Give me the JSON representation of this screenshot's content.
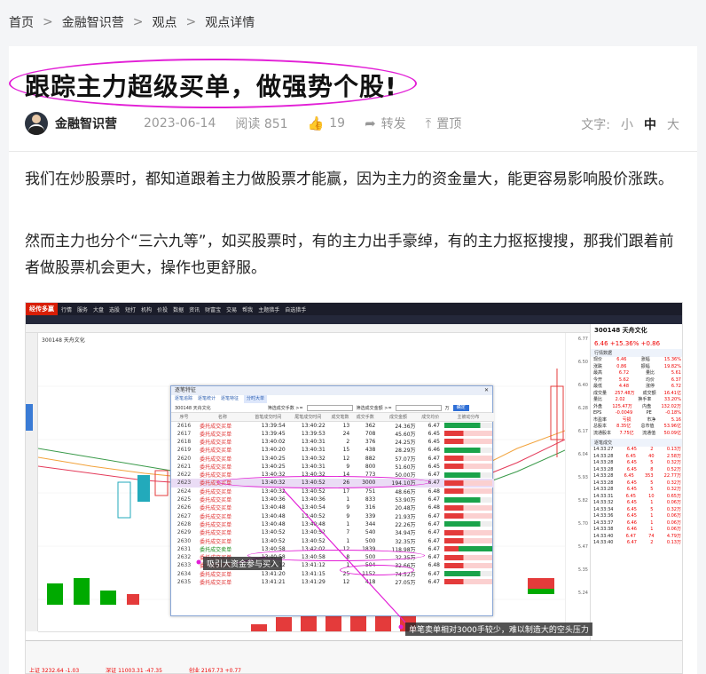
{
  "breadcrumb": {
    "items": [
      "首页",
      "金融智识营",
      "观点",
      "观点详情"
    ],
    "separator": ">"
  },
  "article": {
    "title": "跟踪主力超级买单，做强势个股!",
    "author": "金融智识营",
    "date": "2023-06-14",
    "views_label": "阅读 851",
    "likes": "19",
    "forward_label": "转发",
    "pin_label": "置顶",
    "fontsize_label": "文字:",
    "fontsize_options": [
      "小",
      "中",
      "大"
    ],
    "fontsize_active": "中",
    "paragraphs": [
      "我们在炒股票时，都知道跟着主力做股票才能赢，因为主力的资金量大，能更容易影响股价涨跌。",
      "然而主力也分个“三六九等”，如买股票时，有的主力出手豪绰，有的主力抠抠搜搜，那我们跟着前者做股票机会更大，操作也更舒服。"
    ]
  },
  "screenshot": {
    "app_name": "经传多赢",
    "menu": [
      "行情",
      "服务",
      "大盘",
      "选股",
      "短打",
      "机构",
      "价投",
      "数据",
      "资讯",
      "财富宝",
      "交易",
      "帮我",
      "主题猎手",
      "自选猎手"
    ],
    "stock": {
      "code_name": "300148 天舟文化",
      "price": "6.46",
      "change": "+15.36%",
      "change_abs": "+0.86"
    },
    "annotation_1": "吸引大资金参与买入",
    "annotation_2": "单笔卖单相对3000手较少，难以制造大的空头压力",
    "dialog": {
      "title": "逐笔特征",
      "tabs": [
        "逐笔追踪",
        "逐笔统计",
        "逐笔特征",
        "分时大单"
      ],
      "stock": "300148 天舟文化",
      "filter1_label": "筛选成交手数 >=",
      "filter2_label": "筛选成交金额 >=",
      "filter_unit": "万",
      "confirm": "确定",
      "columns": [
        "序号",
        "名称",
        "首笔成交时间",
        "尾笔成交时间",
        "成交笔数",
        "成交手数",
        "成交金额",
        "成交均价",
        "主被动分布"
      ],
      "rows": [
        [
          "2616",
          "委托成交买单",
          "13:39:54",
          "13:40:22",
          "13",
          "362",
          "24.36万",
          "6.47"
        ],
        [
          "2617",
          "委托成交买单",
          "13:39:45",
          "13:39:53",
          "24",
          "708",
          "45.60万",
          "6.45"
        ],
        [
          "2618",
          "委托成交买单",
          "13:40:02",
          "13:40:31",
          "2",
          "376",
          "24.25万",
          "6.45"
        ],
        [
          "2619",
          "委托成交买单",
          "13:40:20",
          "13:40:31",
          "15",
          "438",
          "28.29万",
          "6.46"
        ],
        [
          "2620",
          "委托成交买单",
          "13:40:25",
          "13:40:32",
          "12",
          "882",
          "57.07万",
          "6.47"
        ],
        [
          "2621",
          "委托成交买单",
          "13:40:25",
          "13:40:31",
          "9",
          "800",
          "51.60万",
          "6.45"
        ],
        [
          "2622",
          "委托成交买单",
          "13:40:32",
          "13:40:32",
          "14",
          "773",
          "50.00万",
          "6.47"
        ],
        [
          "2623",
          "委托成交买单",
          "13:40:32",
          "13:40:52",
          "26",
          "3000",
          "194.10万",
          "6.47"
        ],
        [
          "2624",
          "委托成交买单",
          "13:40:32",
          "13:40:52",
          "17",
          "751",
          "48.66万",
          "6.48"
        ],
        [
          "2625",
          "委托成交买单",
          "13:40:36",
          "13:40:36",
          "1",
          "833",
          "53.90万",
          "6.47"
        ],
        [
          "2626",
          "委托成交买单",
          "13:40:48",
          "13:40:54",
          "9",
          "316",
          "20.48万",
          "6.48"
        ],
        [
          "2627",
          "委托成交买单",
          "13:40:48",
          "13:40:52",
          "9",
          "339",
          "21.93万",
          "6.47"
        ],
        [
          "2628",
          "委托成交买单",
          "13:40:48",
          "13:40:48",
          "1",
          "344",
          "22.26万",
          "6.47"
        ],
        [
          "2629",
          "委托成交买单",
          "13:40:52",
          "13:40:52",
          "7",
          "540",
          "34.94万",
          "6.47"
        ],
        [
          "2630",
          "委托成交买单",
          "13:40:52",
          "13:40:52",
          "1",
          "500",
          "32.35万",
          "6.47"
        ],
        [
          "2631",
          "委托成交卖单",
          "13:40:58",
          "13:42:02",
          "12",
          "1839",
          "118.98万",
          "6.47"
        ],
        [
          "2632",
          "委托成交买单",
          "13:40:58",
          "13:40:58",
          "8",
          "500",
          "32.35万",
          "6.47"
        ],
        [
          "2633",
          "委托成交买单",
          "13:41:12",
          "13:41:12",
          "1",
          "504",
          "32.66万",
          "6.48"
        ],
        [
          "2634",
          "委托成交买单",
          "13:41:20",
          "13:41:15",
          "25",
          "1152",
          "74.52万",
          "6.47"
        ],
        [
          "2635",
          "委托成交买单",
          "13:41:21",
          "13:41:29",
          "12",
          "418",
          "27.05万",
          "6.47"
        ]
      ]
    },
    "right_panel": {
      "section1": "行情数据",
      "rows": [
        [
          "现价",
          "6.46",
          "涨幅",
          "15.36%"
        ],
        [
          "涨跌",
          "0.86",
          "振幅",
          "19.82%"
        ],
        [
          "最高",
          "6.72",
          "量比",
          "5.61"
        ],
        [
          "今开",
          "5.62",
          "均价",
          "6.37"
        ],
        [
          "最低",
          "4.48",
          "涨停",
          "6.72"
        ],
        [
          "成交量",
          "257.48万",
          "成交额",
          "16.41亿"
        ],
        [
          "量比",
          "2.02",
          "换手率",
          "33.20%"
        ],
        [
          "外盘",
          "125.47万",
          "内盘",
          "132.02万"
        ],
        [
          "EPS",
          "-0.0049",
          "PE",
          "-0.18%"
        ],
        [
          "市盈率",
          "亏损",
          "市净",
          "5.16"
        ],
        [
          "总股本",
          "8.35亿",
          "总市值",
          "53.96亿"
        ],
        [
          "流通股本",
          "7.75亿",
          "流通值",
          "50.09亿"
        ]
      ],
      "section2": "逐笔成交",
      "ticks": [
        [
          "14:33:27",
          "6.45",
          "2",
          "0.13万"
        ],
        [
          "14:33:28",
          "6.45",
          "40",
          "2.58万"
        ],
        [
          "14:33:28",
          "6.45",
          "5",
          "0.32万"
        ],
        [
          "14:33:28",
          "6.45",
          "8",
          "0.52万"
        ],
        [
          "14:33:28",
          "6.45",
          "353",
          "22.77万"
        ],
        [
          "14:33:28",
          "6.45",
          "5",
          "0.32万"
        ],
        [
          "14:33:28",
          "6.45",
          "5",
          "0.32万"
        ],
        [
          "14:33:31",
          "6.45",
          "10",
          "0.65万"
        ],
        [
          "14:33:32",
          "6.45",
          "1",
          "0.06万"
        ],
        [
          "14:33:34",
          "6.45",
          "5",
          "0.32万"
        ],
        [
          "14:33:36",
          "6.45",
          "1",
          "0.06万"
        ],
        [
          "14:33:37",
          "6.46",
          "1",
          "0.06万"
        ],
        [
          "14:33:38",
          "6.46",
          "1",
          "0.06万"
        ],
        [
          "14:33:40",
          "6.47",
          "74",
          "4.79万"
        ],
        [
          "14:33:40",
          "6.47",
          "2",
          "0.13万"
        ]
      ]
    },
    "price_axis": [
      "6.77",
      "6.50",
      "6.40",
      "6.28",
      "6.17",
      "6.04",
      "5.93",
      "5.82",
      "5.70",
      "5.47",
      "5.35",
      "5.24"
    ],
    "bottom_index": [
      "上证 3232.64 -1.03",
      "深证 11003.31 -47.35",
      "创业 2167.73 +0.77"
    ]
  }
}
